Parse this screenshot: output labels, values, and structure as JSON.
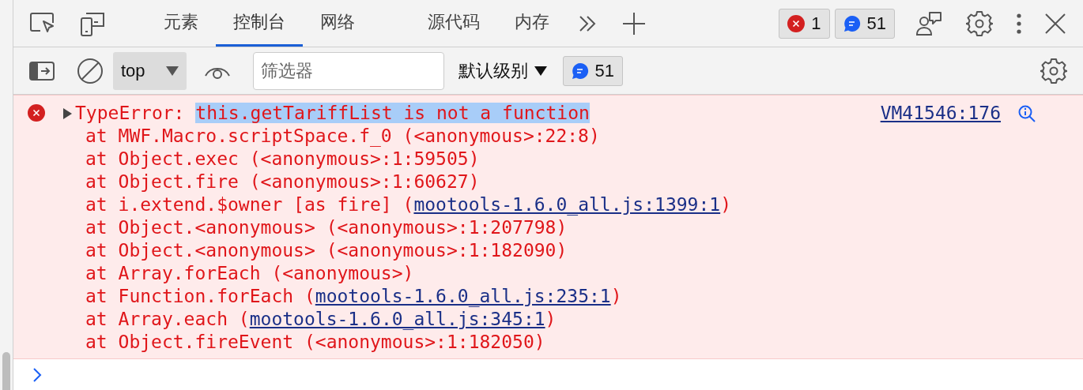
{
  "tabs": [
    {
      "label": "元素",
      "selected": false
    },
    {
      "label": "控制台",
      "selected": true
    },
    {
      "label": "网络",
      "selected": false
    },
    {
      "label": "源代码",
      "selected": false
    },
    {
      "label": "内存",
      "selected": false
    }
  ],
  "issue_counters": {
    "errors": "1",
    "messages": "51"
  },
  "toolbar": {
    "context": "top",
    "filter_placeholder": "筛选器",
    "level": "默认级别",
    "messages": "51"
  },
  "console": {
    "error": {
      "expanded": false,
      "prefix": "TypeError: ",
      "highlighted": "this.getTariffList is not a function",
      "source": "VM41546:176",
      "stack": [
        {
          "text": "at MWF.Macro.scriptSpace.f_0 (<anonymous>:22:8)"
        },
        {
          "text": "at Object.exec (<anonymous>:1:59505)"
        },
        {
          "text": "at Object.fire (<anonymous>:1:60627)"
        },
        {
          "text": "at i.extend.$owner [as fire] (",
          "link": "mootools-1.6.0_all.js:1399:1",
          "after": ")"
        },
        {
          "text": "at Object.<anonymous> (<anonymous>:1:207798)"
        },
        {
          "text": "at Object.<anonymous> (<anonymous>:1:182090)"
        },
        {
          "text": "at Array.forEach (<anonymous>)"
        },
        {
          "text": "at Function.forEach (",
          "link": "mootools-1.6.0_all.js:235:1",
          "after": ")"
        },
        {
          "text": "at Array.each (",
          "link": "mootools-1.6.0_all.js:345:1",
          "after": ")"
        },
        {
          "text": "at Object.fireEvent (<anonymous>:1:182050)"
        }
      ]
    }
  }
}
